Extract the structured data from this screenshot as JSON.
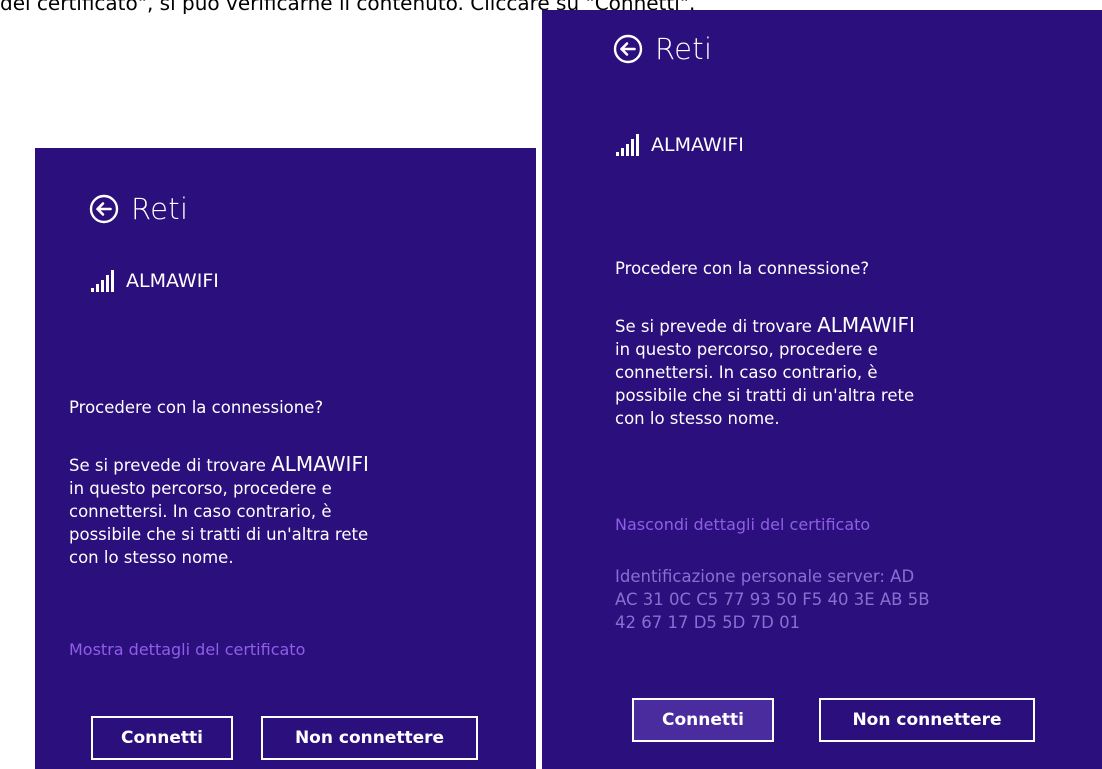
{
  "caption": "del certificato\", si può verificarne il contenuto. Cliccare su \"Connetti\".",
  "colors": {
    "panel_background": "#2b0f7c",
    "link": "#8e5fe6",
    "certificate_text": "#8a6fd2",
    "button_hover": "#4a2c9e"
  },
  "left_panel": {
    "header": {
      "back_icon": "back-arrow-circle-icon",
      "title": "Reti"
    },
    "network": {
      "signal_icon": "wifi-signal-bars-icon",
      "ssid": "ALMAWIFI"
    },
    "question": "Procedere con la connessione?",
    "body": {
      "before": "Se si prevede di trovare ",
      "ssid": "ALMAWIFI",
      "after_line1": "in questo percorso, procedere e",
      "line2": "connettersi. In caso contrario, è",
      "line3": "possibile che si tratti di un'altra rete",
      "line4": "con lo stesso nome."
    },
    "cert_link": "Mostra dettagli del certificato",
    "buttons": {
      "connect": "Connetti",
      "dont_connect": "Non connettere"
    }
  },
  "right_panel": {
    "header": {
      "back_icon": "back-arrow-circle-icon",
      "title": "Reti"
    },
    "network": {
      "signal_icon": "wifi-signal-bars-icon",
      "ssid": "ALMAWIFI"
    },
    "question": "Procedere con la connessione?",
    "body": {
      "before": "Se si prevede di trovare ",
      "ssid": "ALMAWIFI",
      "after_line1": "in questo percorso, procedere e",
      "line2": "connettersi. In caso contrario, è",
      "line3": "possibile che si tratti di un'altra rete",
      "line4": "con lo stesso nome."
    },
    "cert_link": "Nascondi dettagli del certificato",
    "cert_details": {
      "line1": "Identificazione personale server: AD",
      "line2": "AC 31 0C C5 77 93 50 F5 40 3E AB 5B",
      "line3": "42 67 17 D5 5D 7D 01"
    },
    "buttons": {
      "connect": "Connetti",
      "dont_connect": "Non connettere"
    }
  }
}
